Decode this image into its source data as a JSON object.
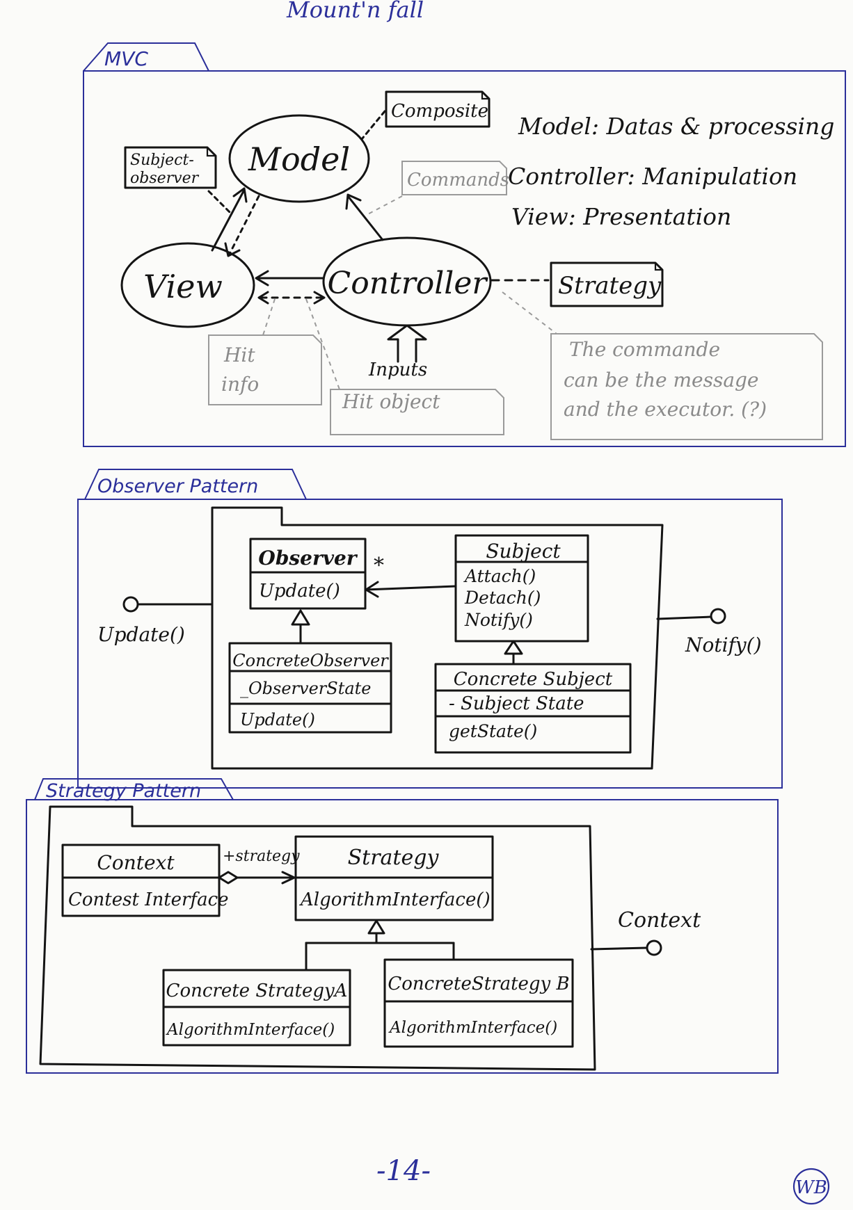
{
  "page": {
    "header": "Mount'n fall",
    "page_number": "-14-",
    "signature": "WB"
  },
  "mvc": {
    "tab": "MVC",
    "model": "Model",
    "view": "View",
    "controller": "Controller",
    "composite": "Composite",
    "subject_observer_line1": "Subject-",
    "subject_observer_line2": "observer",
    "commands": "Commands",
    "strategy": "Strategy",
    "inputs": "Inputs",
    "hit_info_line1": "Hit",
    "hit_info_line2": "info",
    "hit_object": "Hit object",
    "desc_model": "Model: Datas & processing",
    "desc_controller": "Controller: Manipulation",
    "desc_view": "View: Presentation",
    "note_line1": "The commande",
    "note_line2": "can be the message",
    "note_line3": "and the executor. (?)"
  },
  "observer": {
    "tab": "Observer Pattern",
    "observer_title": "Observer",
    "observer_op": "Update()",
    "multiplicity": "*",
    "subject_title": "Subject",
    "subject_ops": [
      "Attach()",
      "Detach()",
      "Notify()"
    ],
    "concrete_observer_title": "ConcreteObserver",
    "concrete_observer_attr": "_ObserverState",
    "concrete_observer_op": "Update()",
    "concrete_subject_title": "Concrete Subject",
    "concrete_subject_attr": "- Subject State",
    "concrete_subject_op": "getState()",
    "left_interface": "Update()",
    "right_interface": "Notify()"
  },
  "strategy_pattern": {
    "tab": "Strategy Pattern",
    "context_title": "Context",
    "context_op": "Contest Interface",
    "role_label": "+strategy",
    "strategy_title": "Strategy",
    "strategy_op": "AlgorithmInterface()",
    "concrete_a_title": "Concrete StrategyA",
    "concrete_a_op": "AlgorithmInterface()",
    "concrete_b_title": "ConcreteStrategy B",
    "concrete_b_op": "AlgorithmInterface()",
    "right_interface": "Context"
  }
}
